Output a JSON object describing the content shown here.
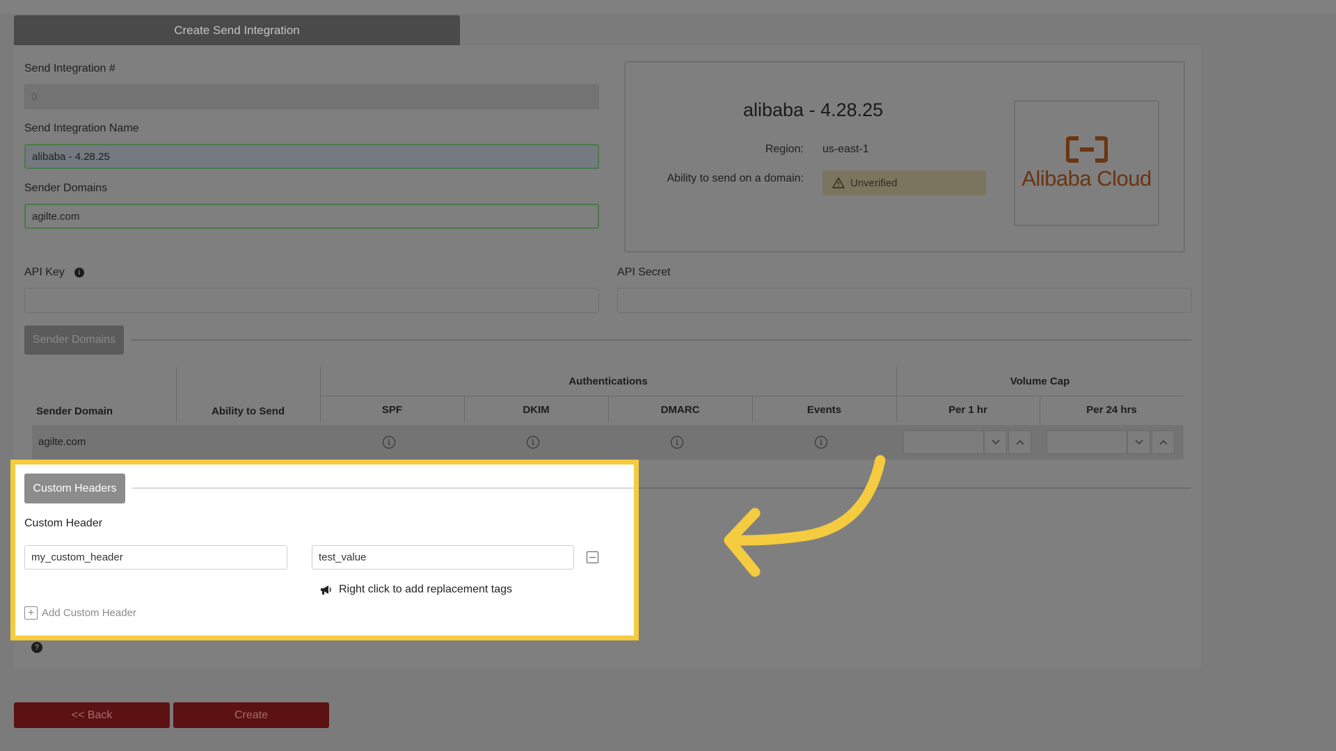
{
  "header": {
    "tab_label": "Create Send Integration"
  },
  "form": {
    "integration_number_label": "Send Integration #",
    "integration_number_value": "0",
    "integration_name_label": "Send Integration Name",
    "integration_name_value": "alibaba - 4.28.25",
    "sender_domains_label": "Sender Domains",
    "sender_domains_value": "agilte.com",
    "api_key_label": "API Key",
    "api_secret_label": "API Secret"
  },
  "info_card": {
    "title": "alibaba - 4.28.25",
    "region_label": "Region:",
    "region_value": "us-east-1",
    "ability_label": "Ability to send on a domain:",
    "status_badge": "Unverified",
    "logo_text": "Alibaba Cloud"
  },
  "sender_domains_section": {
    "button_label": "Sender Domains",
    "group_authentications": "Authentications",
    "group_volume_cap": "Volume Cap",
    "columns": [
      "Sender Domain",
      "Ability to Send",
      "SPF",
      "DKIM",
      "DMARC",
      "Events",
      "Per 1 hr",
      "Per 24 hrs"
    ],
    "rows": [
      {
        "domain": "agilte.com"
      }
    ]
  },
  "custom_headers": {
    "button_label": "Custom Headers",
    "field_label": "Custom Header",
    "header_name_value": "my_custom_header",
    "header_value_value": "test_value",
    "hint_text": "Right click to add replacement tags",
    "add_label": "Add Custom Header"
  },
  "footer": {
    "back_label": "<< Back",
    "create_label": "Create"
  },
  "colors": {
    "highlight": "#f5cb3f",
    "button_primary": "#5c1212",
    "logo_orange": "#6a3512"
  }
}
